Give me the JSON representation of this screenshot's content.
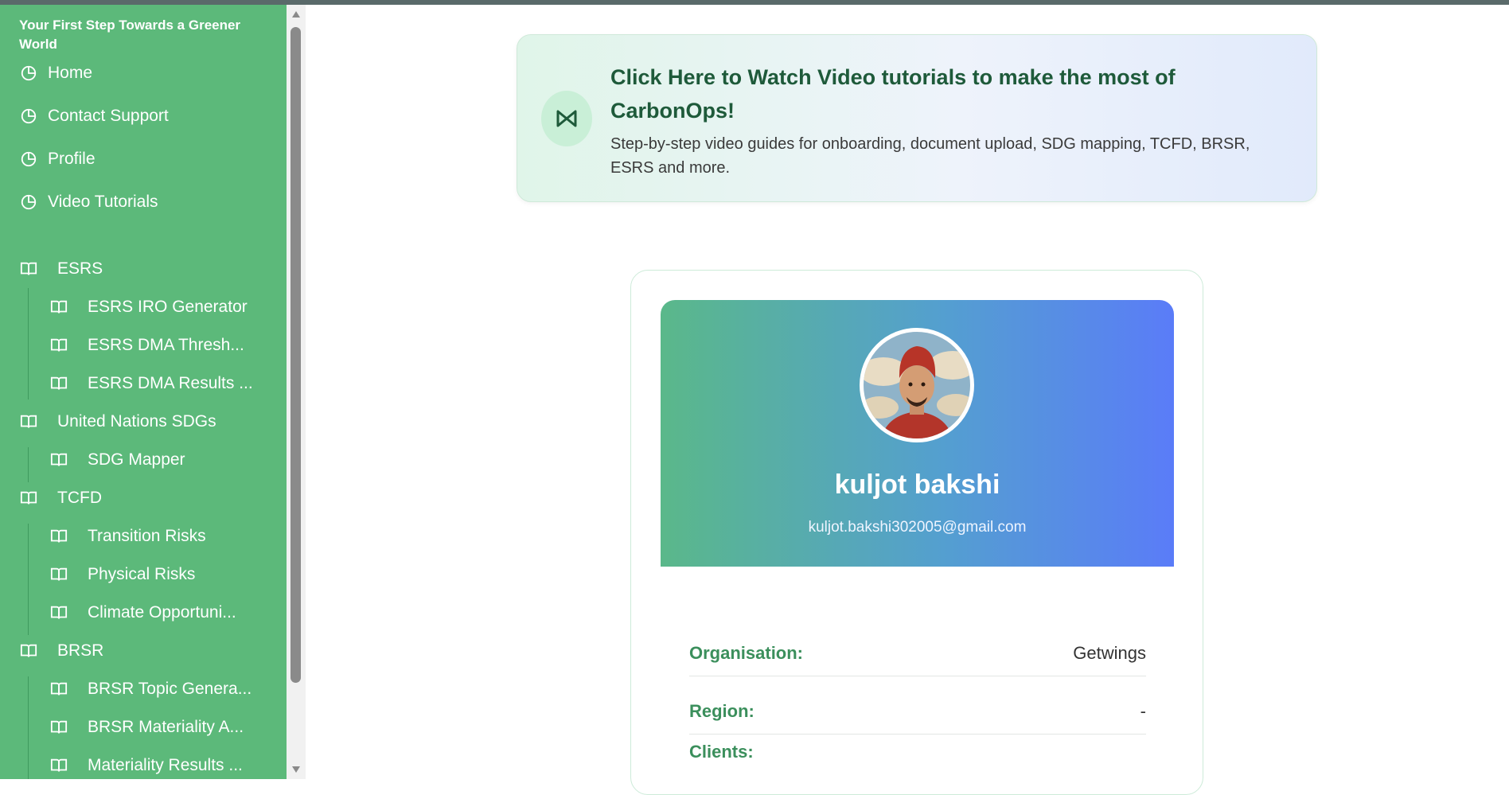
{
  "sidebar": {
    "brand": "Your First Step Towards a Greener World",
    "top_items": [
      {
        "label": "Home",
        "icon": "pie-chart-icon"
      },
      {
        "label": "Contact Support",
        "icon": "pie-chart-icon"
      },
      {
        "label": "Profile",
        "icon": "pie-chart-icon"
      },
      {
        "label": "Video Tutorials",
        "icon": "pie-chart-icon"
      }
    ],
    "groups": [
      {
        "label": "ESRS",
        "items": [
          "ESRS IRO Generator",
          "ESRS DMA Thresh...",
          "ESRS DMA Results ..."
        ]
      },
      {
        "label": "United Nations SDGs",
        "items": [
          "SDG Mapper"
        ]
      },
      {
        "label": "TCFD",
        "items": [
          "Transition Risks",
          "Physical Risks",
          "Climate Opportuni..."
        ]
      },
      {
        "label": "BRSR",
        "items": [
          "BRSR Topic Genera...",
          "BRSR Materiality A...",
          "Materiality Results ..."
        ]
      }
    ]
  },
  "banner": {
    "title": "Click Here to Watch Video tutorials to make the most of CarbonOps!",
    "description": "Step-by-step video guides for onboarding, document upload, SDG mapping, TCFD, BRSR, ESRS and more."
  },
  "profile": {
    "name": "kuljot bakshi",
    "email": "kuljot.bakshi302005@gmail.com",
    "fields": [
      {
        "label": "Organisation:",
        "value": "Getwings"
      },
      {
        "label": "Region:",
        "value": "-"
      }
    ],
    "clients_label": "Clients:"
  },
  "colors": {
    "sidebar_bg": "#5cb97a",
    "accent_green": "#3b8f5c",
    "hero_start": "#5ab88a",
    "hero_end": "#5a7cf8"
  }
}
